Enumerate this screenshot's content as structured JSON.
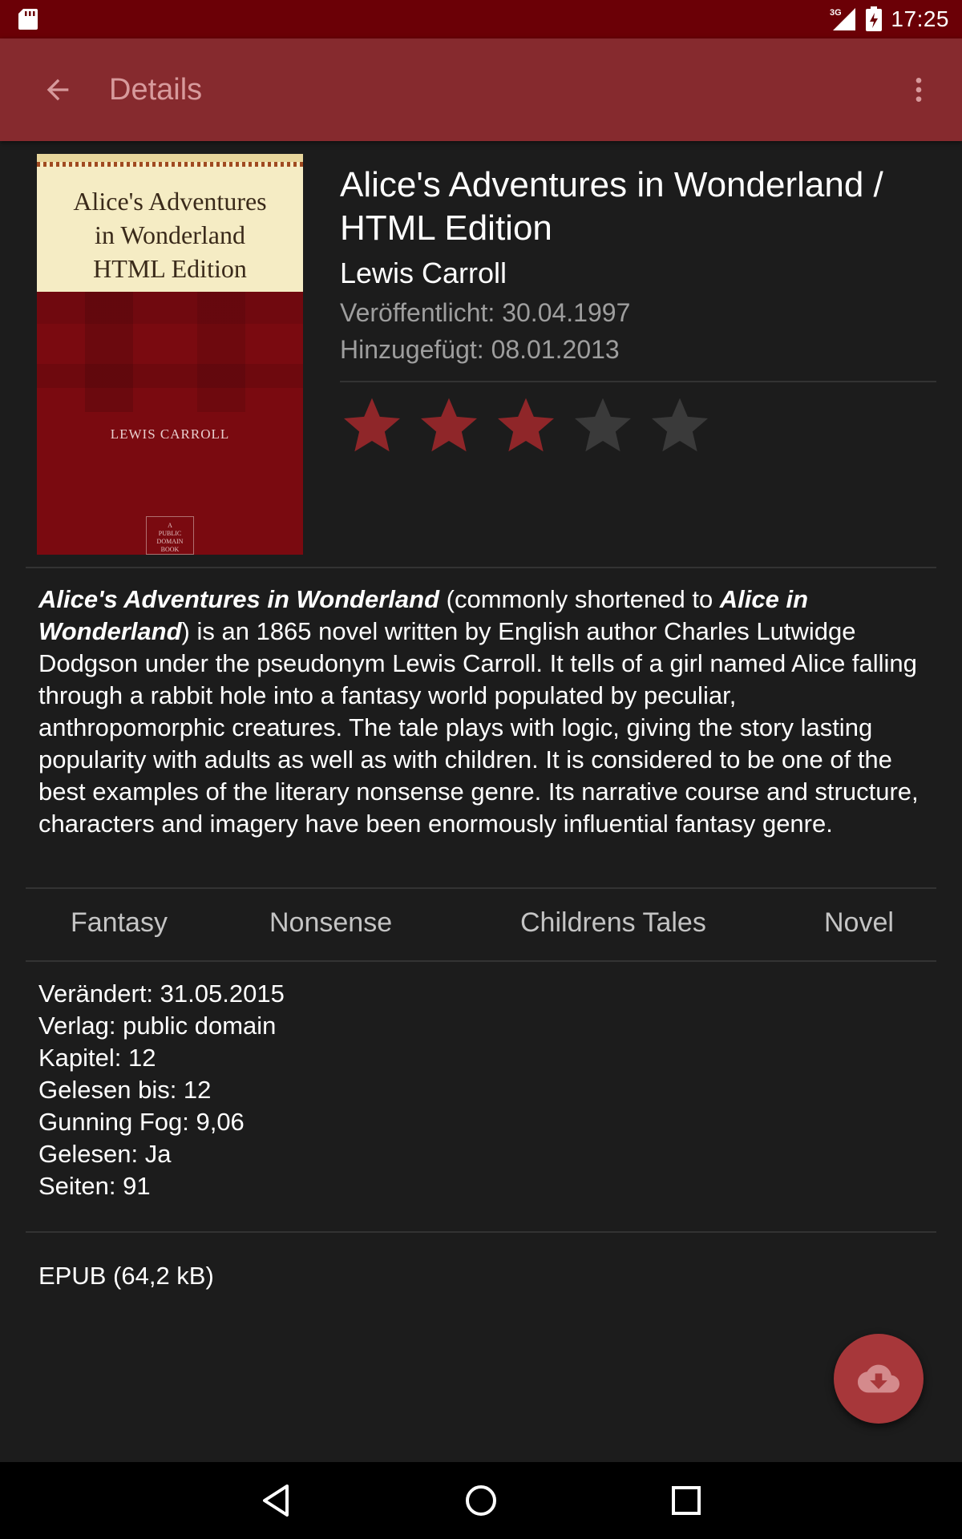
{
  "status_bar": {
    "time": "17:25",
    "network_label": "3G",
    "icons": [
      "sd-card-icon",
      "cell-signal-icon",
      "battery-charging-icon"
    ]
  },
  "app_bar": {
    "title": "Details",
    "back_icon": "arrow-back-icon",
    "menu_icon": "more-vert-icon"
  },
  "book": {
    "cover": {
      "title_text": "Alice's Adventures\nin Wonderland\nHTML Edition",
      "author_text": "LEWIS CARROLL",
      "badge_text": "A\nPUBLIC DOMAIN\nBOOK"
    },
    "title": "Alice's Adventures in Wonderland / HTML Edition",
    "author": "Lewis Carroll",
    "published": "Veröffentlicht: 30.04.1997",
    "added": "Hinzugefügt: 08.01.2013",
    "rating": {
      "value": 3,
      "max": 5
    }
  },
  "description": {
    "title_bold": "Alice's Adventures in Wonderland",
    "part1": " (commonly shortened to ",
    "short_bold": "Alice in Wonderland",
    "part2": ") is an 1865 novel written by English author Charles Lutwidge Dodgson under the pseudonym Lewis Carroll. It tells of a girl named Alice falling through a rabbit hole into a fantasy world populated by peculiar, anthropomorphic creatures. The tale plays with logic, giving the story lasting popularity with adults as well as with children. It is considered to be one of the best examples of the literary nonsense genre. Its narrative course and structure, characters and imagery have been enormously influential fantasy genre."
  },
  "tags": [
    "Fantasy",
    "Nonsense",
    "Childrens Tales",
    "Novel"
  ],
  "meta": [
    "Verändert: 31.05.2015",
    "Verlag: public domain",
    "Kapitel: 12",
    "Gelesen bis: 12",
    "Gunning Fog: 9,06",
    "Gelesen: Ja",
    "Seiten: 91"
  ],
  "format": "EPUB (64,2 kB)",
  "fab": {
    "icon": "cloud-download-icon"
  },
  "nav_bar": {
    "icons": [
      "nav-back-icon",
      "nav-home-icon",
      "nav-recents-icon"
    ]
  },
  "colors": {
    "status_bar": "#6b0006",
    "app_bar": "#862a2e",
    "accent": "#a7373a",
    "star_filled": "#8f2629",
    "star_empty": "#3a3a3a",
    "background": "#1c1c1c"
  }
}
